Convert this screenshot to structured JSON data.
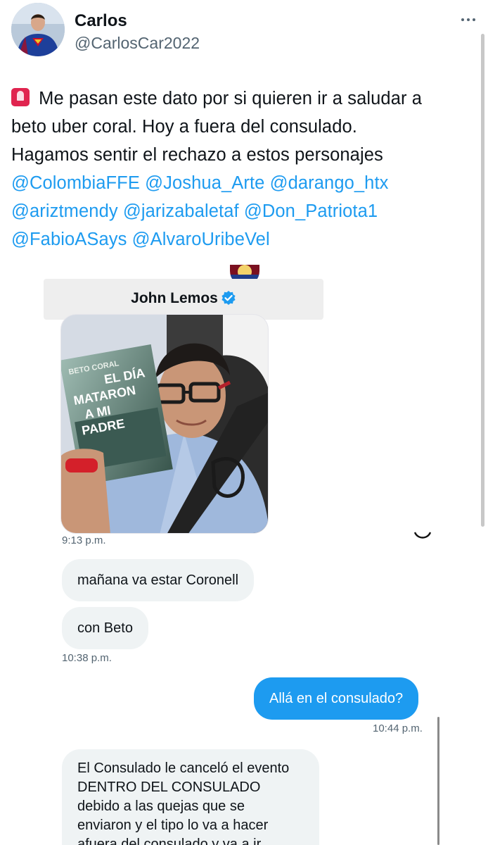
{
  "tweet": {
    "author_name": "Carlos",
    "author_handle": "@CarlosCar2022",
    "text_lines": [
      " Me pasan este dato por si quieren ir a saludar a",
      "beto uber coral. Hoy a fuera del consulado.",
      "Hagamos sentir el rechazo a estos personajes"
    ],
    "mentions": [
      [
        "@ColombiaFFE",
        "@Joshua_Arte",
        "@darango_htx"
      ],
      [
        "@ariztmendy",
        "@jarizabaletaf",
        "@Don_Patriota1"
      ],
      [
        "@FabioASays",
        "@AlvaroUribeVel"
      ]
    ],
    "mention_color": "#1d9bf0"
  },
  "dm": {
    "contact_name": "John Lemos",
    "photo_caption_time": "9:13 p.m.",
    "messages": [
      {
        "text": "mañana va estar Coronell"
      },
      {
        "text": "con Beto"
      },
      {
        "time": "10:38 p.m."
      },
      {
        "text": "Allá en el consulado?"
      },
      {
        "time": "10:44 p.m."
      },
      {
        "text_lines": [
          "El Consulado le canceló el evento",
          "DENTRO DEL CONSULADO",
          "debido a las quejas que se",
          "enviaron y el tipo lo va a hacer",
          "afuera del consulado y va a ir"
        ]
      }
    ],
    "book_cover_text": [
      "BETO CORAL",
      "EL DÍA",
      "MATARON",
      "A MI",
      "PADRE"
    ],
    "accent": "#1d9bf0",
    "incoming_bubble": "#eff3f4"
  }
}
